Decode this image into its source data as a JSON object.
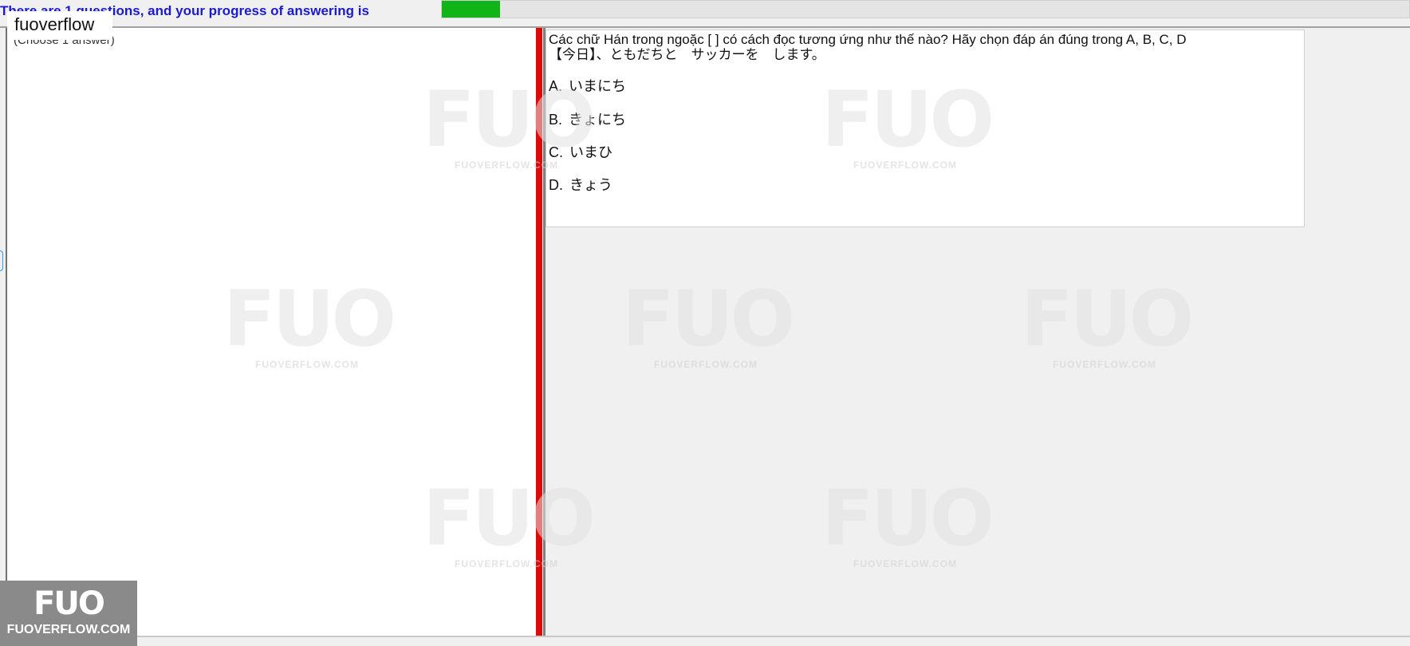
{
  "header": {
    "progress_text": "There are 1 questions, and your progress of answering is",
    "progress_percent": 6,
    "progress_color": "#10b418"
  },
  "left_panel": {
    "choose_label": "(Choose 1 answer)"
  },
  "question": {
    "prompt": "Các chữ Hán trong ngoặc [   ]  có cách đọc tương ứng như thế nào? Hãy chọn đáp án đúng trong A, B, C, D",
    "sentence": "【今日】、ともだちと　サッカーを　します。",
    "options": [
      {
        "letter": "A.",
        "text": "いまにち"
      },
      {
        "letter": "B.",
        "text": "きょにち"
      },
      {
        "letter": "C.",
        "text": "いまひ"
      },
      {
        "letter": "D.",
        "text": "きょう"
      }
    ]
  },
  "branding": {
    "label": "fuoverflow",
    "badge_logo": "FUO",
    "badge_site": "FUOVERFLOW.COM",
    "watermark_logo": "FUO",
    "watermark_site": "FUOVERFLOW.COM"
  },
  "colors": {
    "splitter": "#dd0a0a",
    "progress_text": "#1a1ad0"
  }
}
